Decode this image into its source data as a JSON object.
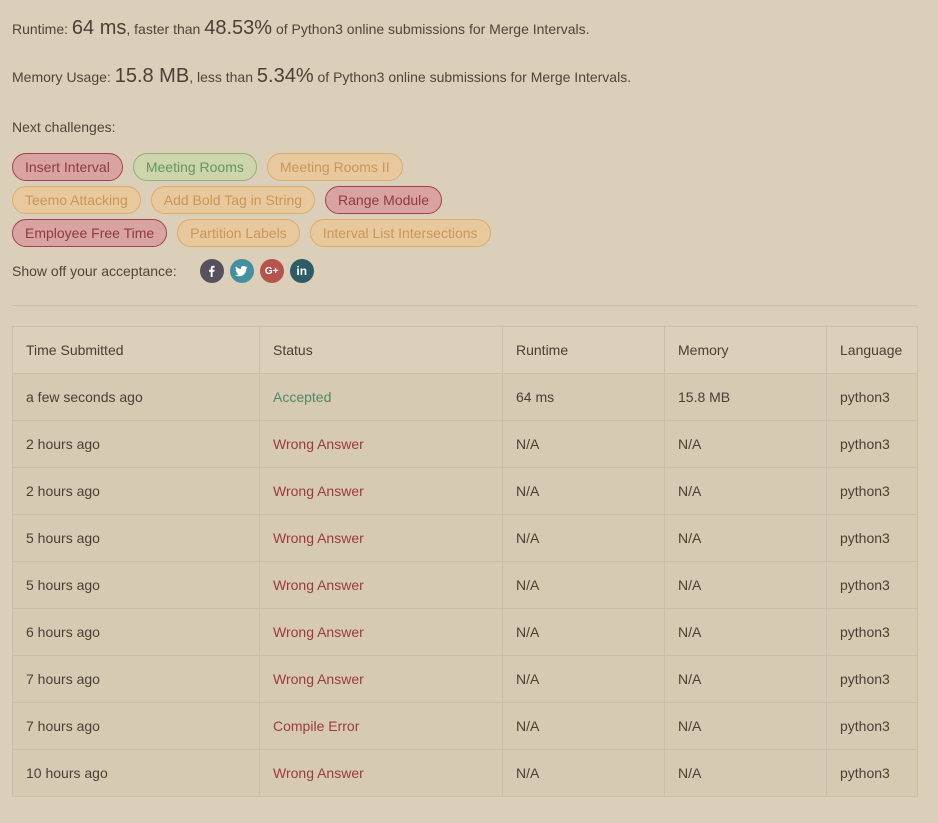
{
  "result": {
    "runtime_prefix": "Runtime: ",
    "runtime_value": "64 ms",
    "runtime_mid": ", faster than ",
    "runtime_percent": "48.53%",
    "runtime_suffix": " of Python3 online submissions for Merge Intervals.",
    "memory_prefix": "Memory Usage: ",
    "memory_value": "15.8 MB",
    "memory_mid": ", less than ",
    "memory_percent": "5.34%",
    "memory_suffix": " of Python3 online submissions for Merge Intervals."
  },
  "next_challenges": {
    "title": "Next challenges:",
    "rows": [
      [
        {
          "label": "Insert Interval",
          "difficulty": "hard"
        },
        {
          "label": "Meeting Rooms",
          "difficulty": "easy"
        },
        {
          "label": "Meeting Rooms II",
          "difficulty": "medium"
        }
      ],
      [
        {
          "label": "Teemo Attacking",
          "difficulty": "medium"
        },
        {
          "label": "Add Bold Tag in String",
          "difficulty": "medium"
        },
        {
          "label": "Range Module",
          "difficulty": "hard"
        }
      ],
      [
        {
          "label": "Employee Free Time",
          "difficulty": "hard"
        },
        {
          "label": "Partition Labels",
          "difficulty": "medium"
        },
        {
          "label": "Interval List Intersections",
          "difficulty": "medium"
        }
      ]
    ]
  },
  "share": {
    "label": "Show off your acceptance:",
    "icons": [
      {
        "name": "facebook-icon",
        "glyph": "f",
        "color": "#56515a"
      },
      {
        "name": "twitter-icon",
        "glyph": "t",
        "color": "#4590a0"
      },
      {
        "name": "google-plus-icon",
        "glyph": "G+",
        "color": "#b5544c"
      },
      {
        "name": "linkedin-icon",
        "glyph": "in",
        "color": "#2d5b66"
      }
    ]
  },
  "submissions": {
    "headers": [
      "Time Submitted",
      "Status",
      "Runtime",
      "Memory",
      "Language"
    ],
    "rows": [
      {
        "time": "a few seconds ago",
        "status": "Accepted",
        "status_type": "accepted",
        "runtime": "64 ms",
        "memory": "15.8 MB",
        "language": "python3"
      },
      {
        "time": "2 hours ago",
        "status": "Wrong Answer",
        "status_type": "wrong",
        "runtime": "N/A",
        "memory": "N/A",
        "language": "python3"
      },
      {
        "time": "2 hours ago",
        "status": "Wrong Answer",
        "status_type": "wrong",
        "runtime": "N/A",
        "memory": "N/A",
        "language": "python3"
      },
      {
        "time": "5 hours ago",
        "status": "Wrong Answer",
        "status_type": "wrong",
        "runtime": "N/A",
        "memory": "N/A",
        "language": "python3"
      },
      {
        "time": "5 hours ago",
        "status": "Wrong Answer",
        "status_type": "wrong",
        "runtime": "N/A",
        "memory": "N/A",
        "language": "python3"
      },
      {
        "time": "6 hours ago",
        "status": "Wrong Answer",
        "status_type": "wrong",
        "runtime": "N/A",
        "memory": "N/A",
        "language": "python3"
      },
      {
        "time": "7 hours ago",
        "status": "Wrong Answer",
        "status_type": "wrong",
        "runtime": "N/A",
        "memory": "N/A",
        "language": "python3"
      },
      {
        "time": "7 hours ago",
        "status": "Compile Error",
        "status_type": "wrong",
        "runtime": "N/A",
        "memory": "N/A",
        "language": "python3"
      },
      {
        "time": "10 hours ago",
        "status": "Wrong Answer",
        "status_type": "wrong",
        "runtime": "N/A",
        "memory": "N/A",
        "language": "python3"
      }
    ]
  },
  "colors": {
    "background": "#dbcfb9",
    "accepted": "#4b8a64",
    "wrong": "#9c3b3c",
    "hard_tag": "#8d3b40",
    "easy_tag": "#649560",
    "medium_tag": "#c99656"
  }
}
